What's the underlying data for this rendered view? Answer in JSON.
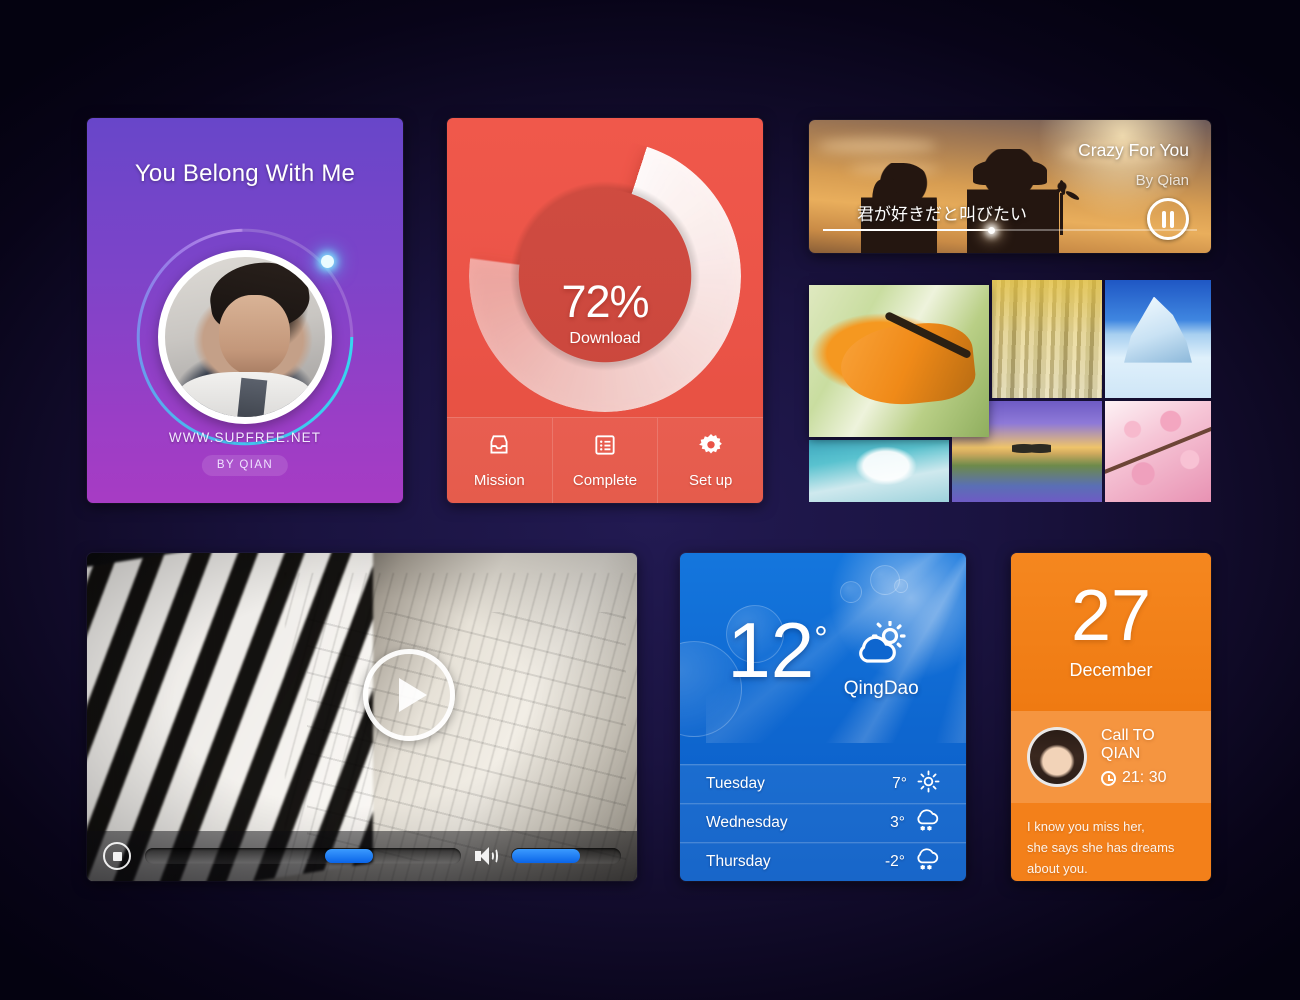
{
  "profile": {
    "title": "You Belong With Me",
    "url": "WWW.SUPFREE.NET",
    "by": "BY QIAN",
    "avatar_icon": "user-avatar",
    "progress_percent": 75
  },
  "download": {
    "percent": "72%",
    "label": "Download",
    "progress_value": 72,
    "accent": "#ea5347",
    "nav": [
      {
        "label": "Mission",
        "icon": "inbox-icon"
      },
      {
        "label": "Complete",
        "icon": "list-icon"
      },
      {
        "label": "Set up",
        "icon": "gear-icon"
      }
    ]
  },
  "music": {
    "title": "Crazy For You",
    "artist": "By Qian",
    "lyric": "君が好きだと叫びたい",
    "pause_icon": "pause-icon",
    "progress_percent": 45
  },
  "photos": [
    {
      "name": "snake",
      "caption": "orange-snake-photo"
    },
    {
      "name": "forest",
      "caption": "autumn-birch-forest-photo"
    },
    {
      "name": "ice",
      "caption": "iceberg-photo"
    },
    {
      "name": "tree",
      "caption": "frost-tree-photo"
    },
    {
      "name": "lake",
      "caption": "sunset-lake-photo"
    },
    {
      "name": "sakura",
      "caption": "cherry-blossom-photo"
    }
  ],
  "video": {
    "poster": "piano-sheet-music",
    "play_icon": "play-icon",
    "stop_icon": "stop-icon",
    "volume_icon": "volume-icon",
    "seek_percent": 57,
    "volume_percent": 62
  },
  "weather": {
    "temp": "12",
    "degree": "°",
    "city": "QingDao",
    "condition_icon": "sun-behind-cloud-icon",
    "forecast": [
      {
        "day": "Tuesday",
        "temp": "7°",
        "icon": "sun-icon"
      },
      {
        "day": "Wednesday",
        "temp": "3°",
        "icon": "snow-cloud-icon"
      },
      {
        "day": "Thursday",
        "temp": "-2°",
        "icon": "snow-cloud-icon"
      }
    ]
  },
  "calendar": {
    "day": "27",
    "month": "December",
    "contact_name": "Call TO QIAN",
    "contact_time": "21: 30",
    "clock_icon": "clock-icon",
    "note_line1": "I know you miss her,",
    "note_line2": "she says she has dreams",
    "note_line3": "about you.",
    "accent": "#f3801a"
  }
}
